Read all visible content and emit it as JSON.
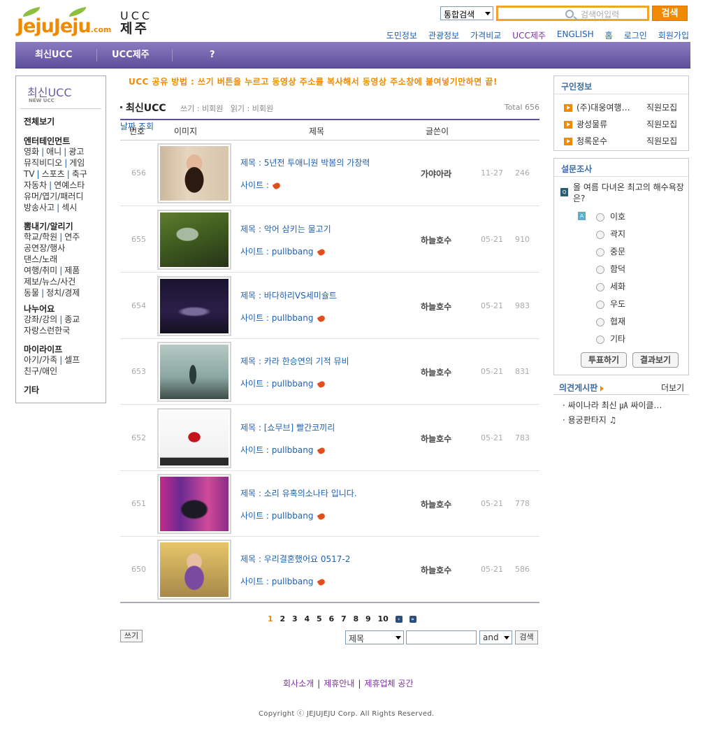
{
  "header": {
    "logo_text": "JejuJeju",
    "logo_domain": ".com",
    "ucc_line1": "UCC",
    "ucc_line2": "제주",
    "search_scope": "통합검색",
    "search_placeholder": "검색어입력",
    "search_button": "검색",
    "top_nav": [
      "도민정보",
      "관광정보",
      "가격비교",
      "UCC제주",
      "ENGLISH",
      "홈",
      "로그인",
      "회원가입"
    ]
  },
  "main_nav": [
    "최신UCC",
    "UCC제주",
    "?"
  ],
  "sidebar": {
    "title": "최신UCC",
    "subtitle": "NEW UCC",
    "all": "전체보기",
    "cats": [
      {
        "name": "엔터테인먼트",
        "lines": [
          [
            "영화",
            "애니",
            "광고"
          ],
          [
            "뮤직비디오",
            "게임"
          ],
          [
            "TV",
            "스포츠",
            "축구"
          ],
          [
            "자동차",
            "연예스타"
          ],
          [
            "유머/엽기/패러디"
          ],
          [
            "방송사고",
            "섹시"
          ]
        ]
      },
      {
        "name": "뽐내기/알리기",
        "lines": [
          [
            "학교/학원",
            "연주"
          ],
          [
            "공연장/행사"
          ],
          [
            "댄스/노래"
          ],
          [
            "여행/취미",
            "제품"
          ],
          [
            "제보/뉴스/사건"
          ],
          [
            "동물",
            "정치/경제"
          ]
        ]
      },
      {
        "name": "나누어요",
        "lines": [
          [
            "강좌/강의",
            "종교"
          ],
          [
            "자랑스런한국"
          ]
        ]
      },
      {
        "name": "마이라이프",
        "lines": [
          [
            "아기/가족",
            "셀프"
          ],
          [
            "친구/애인"
          ]
        ]
      },
      {
        "name": "기타",
        "lines": []
      }
    ]
  },
  "notice": "UCC 공유 방법 : 쓰기 버튼을 누르고 동영상 주소를 복사해서 동영상 주소창에 붙여넣기만하면 끝!",
  "board": {
    "title": "최신UCC",
    "write_perm": "쓰기 : 비회원",
    "read_perm": "읽기 : 비회원",
    "total": "Total 656",
    "columns": [
      "번호",
      "이미지",
      "제목",
      "글쓴이",
      "날짜",
      "조회"
    ],
    "rows": [
      {
        "num": "656",
        "title": "제목 : 5년전 투애니원 박봄의 가창력",
        "site": "사이트 :",
        "writer": "가야아라",
        "date": "11-27",
        "views": "246"
      },
      {
        "num": "655",
        "title": "제목 : 악어 삼키는 물고기",
        "site": "사이트 : pullbbang",
        "writer": "하늘호수",
        "date": "05-21",
        "views": "910"
      },
      {
        "num": "654",
        "title": "제목 : 바다하리VS세미슐트",
        "site": "사이트 : pullbbang",
        "writer": "하늘호수",
        "date": "05-21",
        "views": "983"
      },
      {
        "num": "653",
        "title": "제목 : 카라 한승연의 기적 뮤비",
        "site": "사이트 : pullbbang",
        "writer": "하늘호수",
        "date": "05-21",
        "views": "831"
      },
      {
        "num": "652",
        "title": "제목 : [쇼무브] 빨간코끼리",
        "site": "사이트 : pullbbang",
        "writer": "하늘호수",
        "date": "05-21",
        "views": "783"
      },
      {
        "num": "651",
        "title": "제목 : 소리 유혹의소나타 입니다.",
        "site": "사이트 : pullbbang",
        "writer": "하늘호수",
        "date": "05-21",
        "views": "778"
      },
      {
        "num": "650",
        "title": "제목 : 우리결혼했어요 0517-2",
        "site": "사이트 : pullbbang",
        "writer": "하늘호수",
        "date": "05-21",
        "views": "586"
      }
    ],
    "pages": [
      "1",
      "2",
      "3",
      "4",
      "5",
      "6",
      "7",
      "8",
      "9",
      "10"
    ],
    "write_button": "쓰기",
    "search_field": "제목",
    "search_op": "and",
    "search_button": "검색"
  },
  "jobs": {
    "title": "구인정보",
    "items": [
      {
        "name": "(주)대웅여행…",
        "tag": "직원모집"
      },
      {
        "name": "광성물류",
        "tag": "직원모집"
      },
      {
        "name": "청록운수",
        "tag": "직원모집"
      }
    ]
  },
  "poll": {
    "title": "설문조사",
    "q_icon": "Q",
    "question": "올 여름 다녀온 최고의 해수욕장은?",
    "a_icon": "A",
    "options": [
      "이호",
      "곽지",
      "중문",
      "함덕",
      "세화",
      "우도",
      "협재",
      "기타"
    ],
    "vote_button": "투표하기",
    "result_button": "결과보기"
  },
  "opinion": {
    "title": "의견게시판",
    "more": "더보기",
    "items": [
      "· 싸이나라 최신 ㎂ 싸이클…",
      "· 용궁판타지 ♫"
    ]
  },
  "footer": {
    "links": [
      "회사소개",
      "제휴안내",
      "제휴업체 공간"
    ],
    "copyright": "Copyright ⓒ JEJUJEJU Corp. All Rights Reserved."
  },
  "colors": {
    "accent": "#f08a00",
    "nav_purple": "#5e4f9c",
    "link_blue": "#2060b0"
  }
}
